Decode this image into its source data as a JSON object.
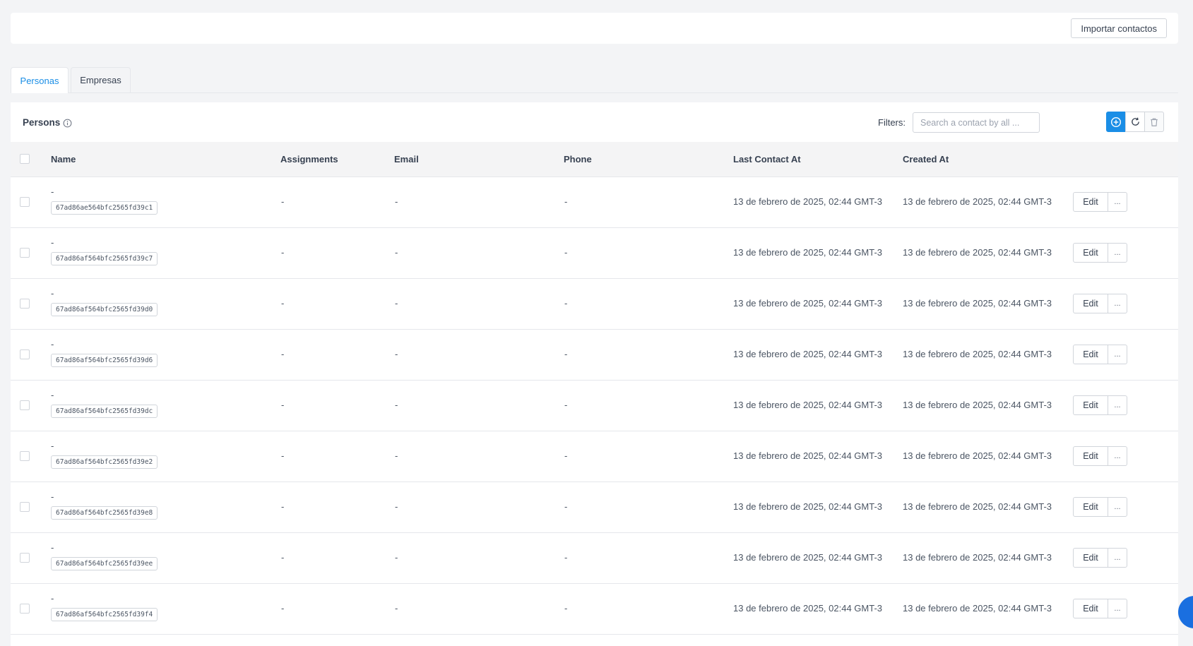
{
  "header": {
    "import_label": "Importar contactos"
  },
  "tabs": [
    {
      "label": "Personas",
      "active": true
    },
    {
      "label": "Empresas",
      "active": false
    }
  ],
  "card": {
    "title": "Persons",
    "filters_label": "Filters:",
    "search_placeholder": "Search a contact by all ...",
    "icons": [
      "plus-circle-icon",
      "refresh-icon",
      "trash-icon"
    ]
  },
  "table": {
    "columns": [
      "Name",
      "Assignments",
      "Email",
      "Phone",
      "Last Contact At",
      "Created At"
    ],
    "edit_label": "Edit",
    "more_label": "...",
    "rows": [
      {
        "name": "-",
        "id": "67ad86ae564bfc2565fd39c1",
        "assignments": "-",
        "email": "-",
        "phone": "-",
        "last_contact": "13 de febrero de 2025, 02:44 GMT-3",
        "created": "13 de febrero de 2025, 02:44 GMT-3"
      },
      {
        "name": "-",
        "id": "67ad86af564bfc2565fd39c7",
        "assignments": "-",
        "email": "-",
        "phone": "-",
        "last_contact": "13 de febrero de 2025, 02:44 GMT-3",
        "created": "13 de febrero de 2025, 02:44 GMT-3"
      },
      {
        "name": "-",
        "id": "67ad86af564bfc2565fd39d0",
        "assignments": "-",
        "email": "-",
        "phone": "-",
        "last_contact": "13 de febrero de 2025, 02:44 GMT-3",
        "created": "13 de febrero de 2025, 02:44 GMT-3"
      },
      {
        "name": "-",
        "id": "67ad86af564bfc2565fd39d6",
        "assignments": "-",
        "email": "-",
        "phone": "-",
        "last_contact": "13 de febrero de 2025, 02:44 GMT-3",
        "created": "13 de febrero de 2025, 02:44 GMT-3"
      },
      {
        "name": "-",
        "id": "67ad86af564bfc2565fd39dc",
        "assignments": "-",
        "email": "-",
        "phone": "-",
        "last_contact": "13 de febrero de 2025, 02:44 GMT-3",
        "created": "13 de febrero de 2025, 02:44 GMT-3"
      },
      {
        "name": "-",
        "id": "67ad86af564bfc2565fd39e2",
        "assignments": "-",
        "email": "-",
        "phone": "-",
        "last_contact": "13 de febrero de 2025, 02:44 GMT-3",
        "created": "13 de febrero de 2025, 02:44 GMT-3"
      },
      {
        "name": "-",
        "id": "67ad86af564bfc2565fd39e8",
        "assignments": "-",
        "email": "-",
        "phone": "-",
        "last_contact": "13 de febrero de 2025, 02:44 GMT-3",
        "created": "13 de febrero de 2025, 02:44 GMT-3"
      },
      {
        "name": "-",
        "id": "67ad86af564bfc2565fd39ee",
        "assignments": "-",
        "email": "-",
        "phone": "-",
        "last_contact": "13 de febrero de 2025, 02:44 GMT-3",
        "created": "13 de febrero de 2025, 02:44 GMT-3"
      },
      {
        "name": "-",
        "id": "67ad86af564bfc2565fd39f4",
        "assignments": "-",
        "email": "-",
        "phone": "-",
        "last_contact": "13 de febrero de 2025, 02:44 GMT-3",
        "created": "13 de febrero de 2025, 02:44 GMT-3"
      }
    ]
  },
  "colors": {
    "accent": "#1a8ee6",
    "floating_button": "#1a6fe0"
  }
}
